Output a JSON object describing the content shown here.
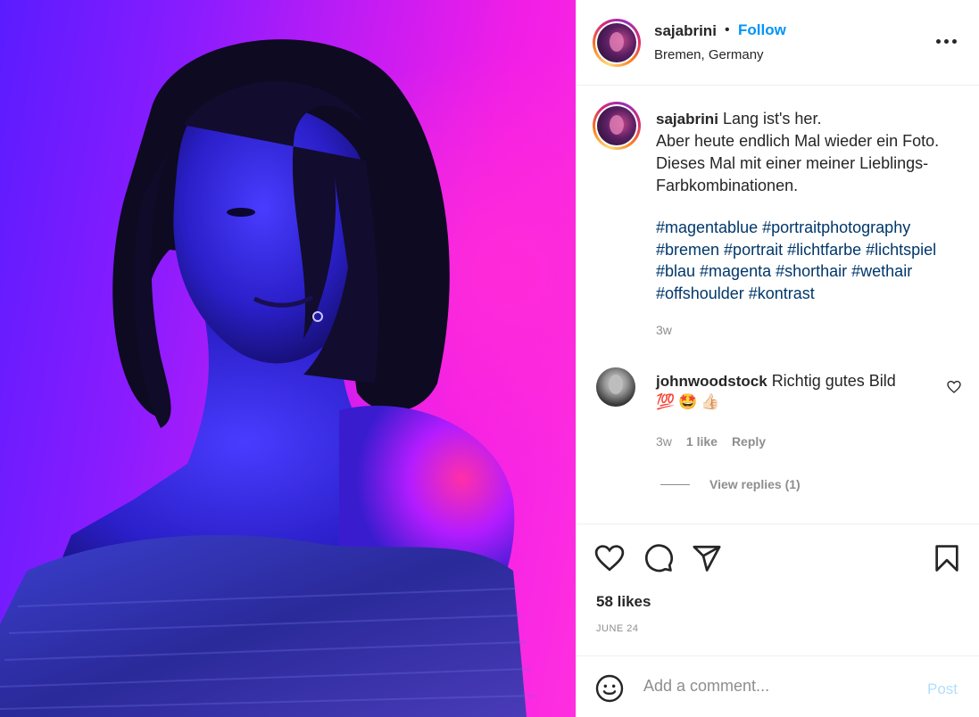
{
  "post": {
    "author": "sajabrini",
    "dot": "•",
    "follow_label": "Follow",
    "location": "Bremen, Germany"
  },
  "caption": {
    "username": "sajabrini",
    "line1": "Lang ist's her.",
    "line2": "Aber heute endlich Mal wieder ein Foto. Dieses Mal mit einer meiner Lieblings-Farbkombinationen.",
    "hashtags": "#magentablue #portraitphotography #bremen #portrait #lichtfarbe #lichtspiel #blau #magenta #shorthair #wethair #offshoulder #kontrast",
    "time": "3w"
  },
  "comment": {
    "username": "johnwoodstock",
    "text": "Richtig gutes Bild",
    "emoji": "💯🤩👍🏻",
    "time": "3w",
    "likes": "1 like",
    "reply_label": "Reply",
    "view_replies": "View replies (1)"
  },
  "stats": {
    "likes": "58 likes",
    "date": "JUNE 24"
  },
  "composer": {
    "placeholder": "Add a comment...",
    "post_label": "Post"
  },
  "icons": {
    "more": "more-options-icon",
    "like": "heart-icon",
    "comment": "comment-icon",
    "share": "share-icon",
    "save": "bookmark-icon",
    "emoji": "emoji-icon"
  },
  "colors": {
    "link": "#0095f6",
    "hashtag": "#00376b",
    "muted": "#8e8e8e",
    "post_disabled": "#b2dffc"
  }
}
